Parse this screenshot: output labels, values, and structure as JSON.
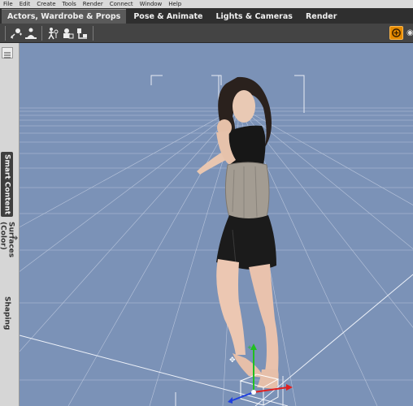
{
  "menu": [
    "File",
    "Edit",
    "Create",
    "Tools",
    "Render",
    "Connect",
    "Window",
    "Help"
  ],
  "tabs": [
    {
      "label": "Actors, Wardrobe & Props",
      "active": true
    },
    {
      "label": "Pose & Animate",
      "active": false
    },
    {
      "label": "Lights & Cameras",
      "active": false
    },
    {
      "label": "Render",
      "active": false
    }
  ],
  "toolbar_icons": [
    "node-selection-icon",
    "figure-icon",
    "joint-editor-icon",
    "surface-selection-icon",
    "region-navigator-icon"
  ],
  "side_tabs": [
    {
      "label": "Smart Content",
      "active": true
    },
    {
      "label": "Surfaces (Color)",
      "active": false
    },
    {
      "label": "Shaping",
      "active": false
    }
  ],
  "colors": {
    "viewport_bg": "#7b92b7",
    "grid": "#c8d2e4",
    "accent": "#e58a00",
    "axis_x": "#e02020",
    "axis_y": "#20c020",
    "axis_z": "#2040e0"
  }
}
